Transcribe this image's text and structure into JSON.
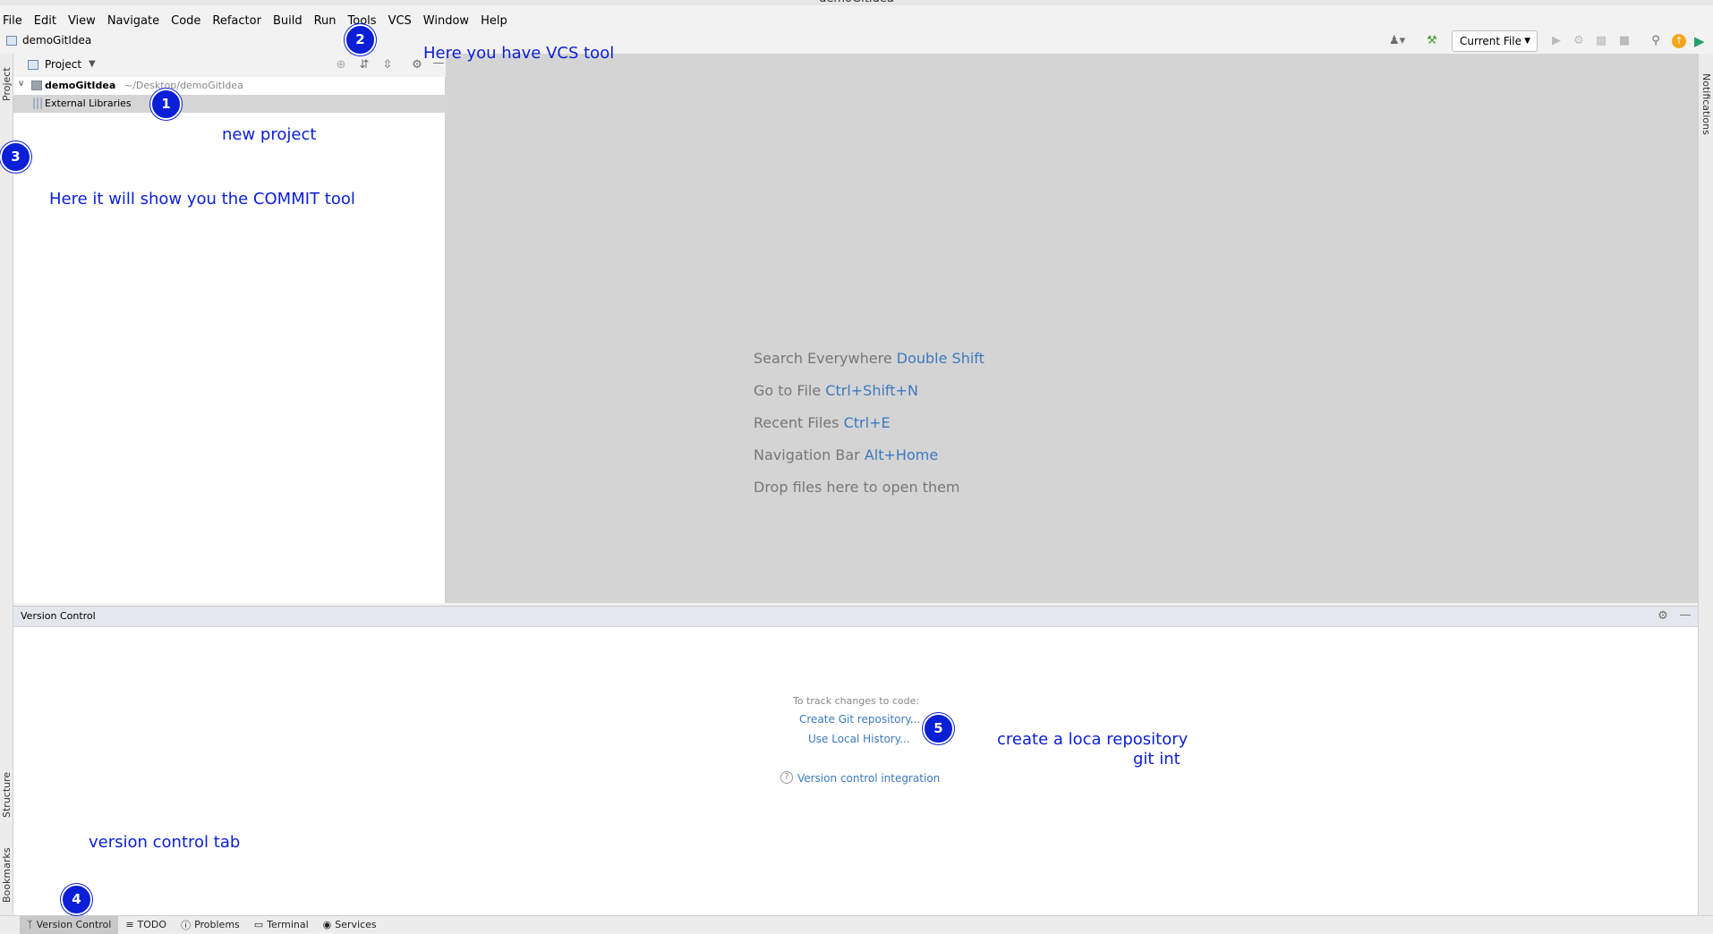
{
  "window": {
    "title": "demoGitIdea"
  },
  "menu": [
    "File",
    "Edit",
    "View",
    "Navigate",
    "Code",
    "Refactor",
    "Build",
    "Run",
    "Tools",
    "VCS",
    "Window",
    "Help"
  ],
  "navbar": {
    "project": "demoGitIdea",
    "run_config": "Current File"
  },
  "left_tabs": {
    "project": "Project",
    "structure": "Structure",
    "bookmarks": "Bookmarks"
  },
  "right_tabs": {
    "notifications": "Notifications"
  },
  "project_panel": {
    "view_selector": "Project",
    "tree": [
      {
        "name": "demoGitIdea",
        "path": "~/Desktop/demoGitIdea"
      },
      {
        "name": "External Libraries"
      }
    ]
  },
  "editor_hints": [
    {
      "text": "Search Everywhere",
      "shortcut": "Double Shift"
    },
    {
      "text": "Go to File",
      "shortcut": "Ctrl+Shift+N"
    },
    {
      "text": "Recent Files",
      "shortcut": "Ctrl+E"
    },
    {
      "text": "Navigation Bar",
      "shortcut": "Alt+Home"
    },
    {
      "text": "Drop files here to open them",
      "shortcut": ""
    }
  ],
  "version_control": {
    "title": "Version Control",
    "empty_title": "To track changes to code:",
    "create_repo": "Create Git repository...",
    "local_history": "Use Local History...",
    "integration": "Version control integration"
  },
  "bottom_tabs": [
    "Version Control",
    "TODO",
    "Problems",
    "Terminal",
    "Services"
  ],
  "annotations": {
    "badges": [
      "1",
      "2",
      "3",
      "4",
      "5"
    ],
    "new_project": "new project",
    "vcs_tool": "Here you have VCS tool",
    "commit_tool": "Here it will show you the COMMIT tool",
    "vc_tab": "version control tab",
    "local_repo_line1": "create a loca repository",
    "local_repo_line2": "git int"
  }
}
